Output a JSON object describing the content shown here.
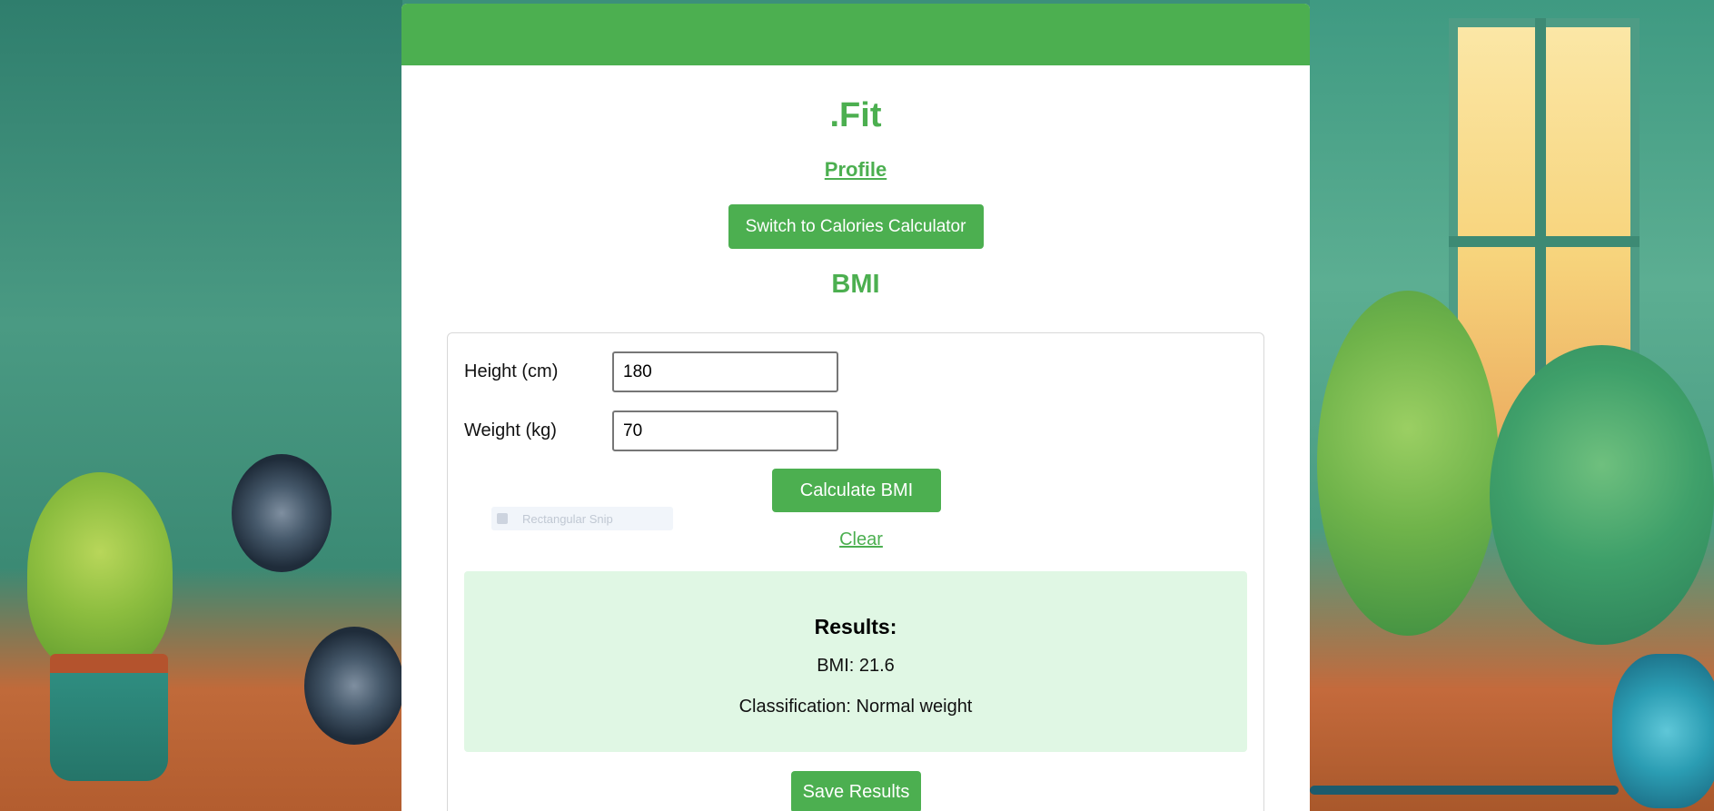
{
  "app": {
    "brand": ".Fit",
    "accent_color": "#4caf50"
  },
  "nav": {
    "profile_label": "Profile"
  },
  "actions": {
    "switch_label": "Switch to Calories Calculator"
  },
  "bmi": {
    "section_title": "BMI",
    "height_label": "Height (cm)",
    "height_value": "180",
    "weight_label": "Weight (kg)",
    "weight_value": "70",
    "calculate_label": "Calculate BMI",
    "clear_label": "Clear",
    "save_label": "Save Results"
  },
  "overlay": {
    "ghost_text": "Rectangular Snip"
  },
  "results": {
    "title": "Results:",
    "bmi_line": "BMI: 21.6",
    "classification_line": "Classification: Normal weight",
    "background_color": "#e0f7e4"
  }
}
